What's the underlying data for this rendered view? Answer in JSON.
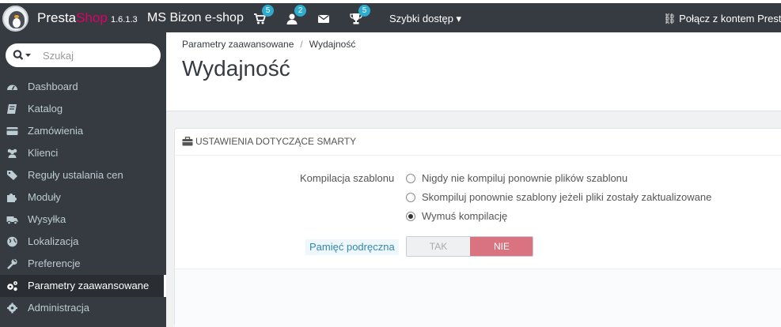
{
  "topbar": {
    "brand_presta": "Presta",
    "brand_shop": "Shop",
    "version": "1.6.1.3",
    "shop_name": "MS Bizon e-shop",
    "badges": {
      "orders": "5",
      "customers": "2",
      "trophy": "5"
    },
    "quick_access": "Szybki dostęp ▾",
    "connect": "Połącz z kontem Prestas"
  },
  "sidebar": {
    "search_placeholder": "Szukaj",
    "items": [
      {
        "label": "Dashboard",
        "icon": "dashboard-icon"
      },
      {
        "label": "Katalog",
        "icon": "book-icon"
      },
      {
        "label": "Zamówienia",
        "icon": "credit-card-icon"
      },
      {
        "label": "Klienci",
        "icon": "users-icon"
      },
      {
        "label": "Reguły ustalania cen",
        "icon": "tags-icon"
      },
      {
        "label": "Moduły",
        "icon": "puzzle-icon"
      },
      {
        "label": "Wysyłka",
        "icon": "truck-icon"
      },
      {
        "label": "Lokalizacja",
        "icon": "globe-icon"
      },
      {
        "label": "Preferencje",
        "icon": "wrench-icon"
      },
      {
        "label": "Parametry zaawansowane",
        "icon": "cogs-icon",
        "active": true
      },
      {
        "label": "Administracja",
        "icon": "cog-icon"
      }
    ]
  },
  "header": {
    "breadcrumb_parent": "Parametry zaawansowane",
    "breadcrumb_sep": "/",
    "breadcrumb_current": "Wydajność",
    "title": "Wydajność"
  },
  "panel": {
    "heading": "USTAWIENIA DOTYCZĄCE SMARTY",
    "compile_label": "Kompilacja szablonu",
    "compile_options": [
      {
        "label": "Nigdy nie kompiluj ponownie plików szablonu",
        "checked": false
      },
      {
        "label": "Skompiluj ponownie szablony jeżeli pliki zostały zaktualizowane",
        "checked": false
      },
      {
        "label": "Wymuś kompilację",
        "checked": true
      }
    ],
    "cache_label": "Pamięć podręczna",
    "cache_yes": "TAK",
    "cache_no": "NIE",
    "cache_value": "NIE"
  },
  "colors": {
    "topbar": "#363a41",
    "brand_accent": "#df0067",
    "badge": "#2eacce",
    "switch_no": "#d8737f"
  }
}
